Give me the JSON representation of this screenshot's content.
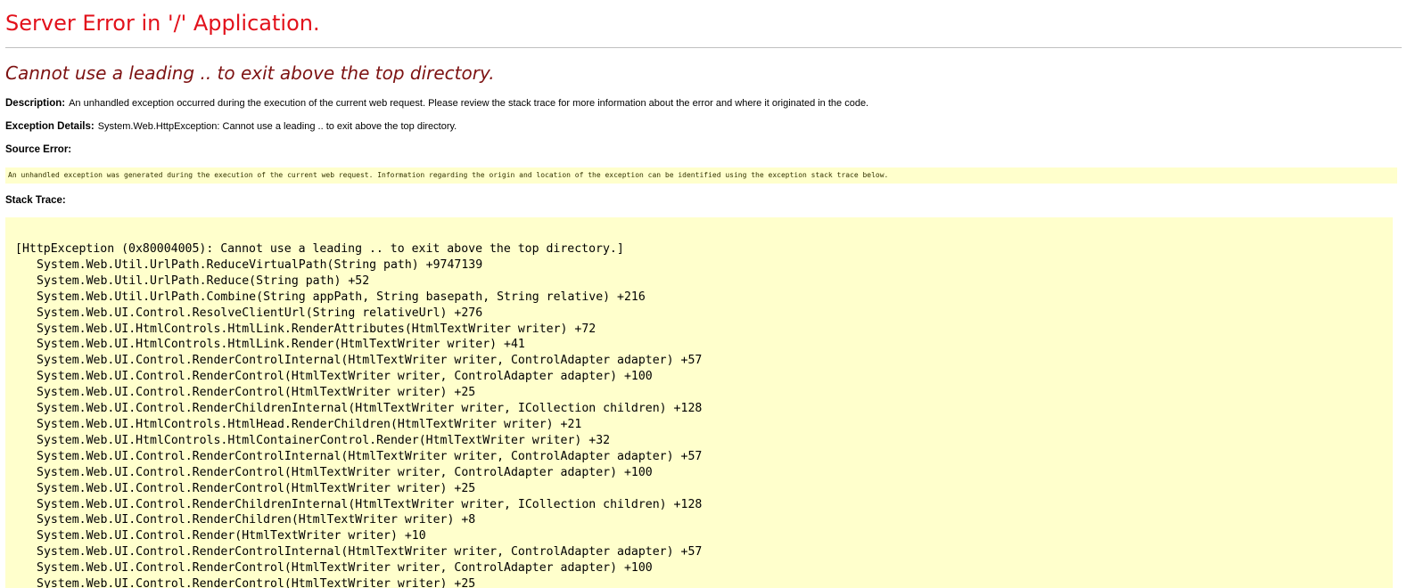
{
  "header": {
    "title": "Server Error in '/' Application.",
    "subtitle": "Cannot use a leading .. to exit above the top directory."
  },
  "description": {
    "label": "Description:",
    "text": "An unhandled exception occurred during the execution of the current web request. Please review the stack trace for more information about the error and where it originated in the code."
  },
  "exception_details": {
    "label": "Exception Details:",
    "text": "System.Web.HttpException: Cannot use a leading .. to exit above the top directory."
  },
  "source_error": {
    "label": "Source Error:",
    "text": "An unhandled exception was generated during the execution of the current web request. Information regarding the origin and location of the exception can be identified using the exception stack trace below."
  },
  "stack_trace": {
    "label": "Stack Trace:",
    "header": "[HttpException (0x80004005): Cannot use a leading .. to exit above the top directory.]",
    "frames": [
      "System.Web.Util.UrlPath.ReduceVirtualPath(String path) +9747139",
      "System.Web.Util.UrlPath.Reduce(String path) +52",
      "System.Web.Util.UrlPath.Combine(String appPath, String basepath, String relative) +216",
      "System.Web.UI.Control.ResolveClientUrl(String relativeUrl) +276",
      "System.Web.UI.HtmlControls.HtmlLink.RenderAttributes(HtmlTextWriter writer) +72",
      "System.Web.UI.HtmlControls.HtmlLink.Render(HtmlTextWriter writer) +41",
      "System.Web.UI.Control.RenderControlInternal(HtmlTextWriter writer, ControlAdapter adapter) +57",
      "System.Web.UI.Control.RenderControl(HtmlTextWriter writer, ControlAdapter adapter) +100",
      "System.Web.UI.Control.RenderControl(HtmlTextWriter writer) +25",
      "System.Web.UI.Control.RenderChildrenInternal(HtmlTextWriter writer, ICollection children) +128",
      "System.Web.UI.HtmlControls.HtmlHead.RenderChildren(HtmlTextWriter writer) +21",
      "System.Web.UI.HtmlControls.HtmlContainerControl.Render(HtmlTextWriter writer) +32",
      "System.Web.UI.Control.RenderControlInternal(HtmlTextWriter writer, ControlAdapter adapter) +57",
      "System.Web.UI.Control.RenderControl(HtmlTextWriter writer, ControlAdapter adapter) +100",
      "System.Web.UI.Control.RenderControl(HtmlTextWriter writer) +25",
      "System.Web.UI.Control.RenderChildrenInternal(HtmlTextWriter writer, ICollection children) +128",
      "System.Web.UI.Control.RenderChildren(HtmlTextWriter writer) +8",
      "System.Web.UI.Control.Render(HtmlTextWriter writer) +10",
      "System.Web.UI.Control.RenderControlInternal(HtmlTextWriter writer, ControlAdapter adapter) +57",
      "System.Web.UI.Control.RenderControl(HtmlTextWriter writer, ControlAdapter adapter) +100",
      "System.Web.UI.Control.RenderControl(HtmlTextWriter writer) +25"
    ]
  }
}
